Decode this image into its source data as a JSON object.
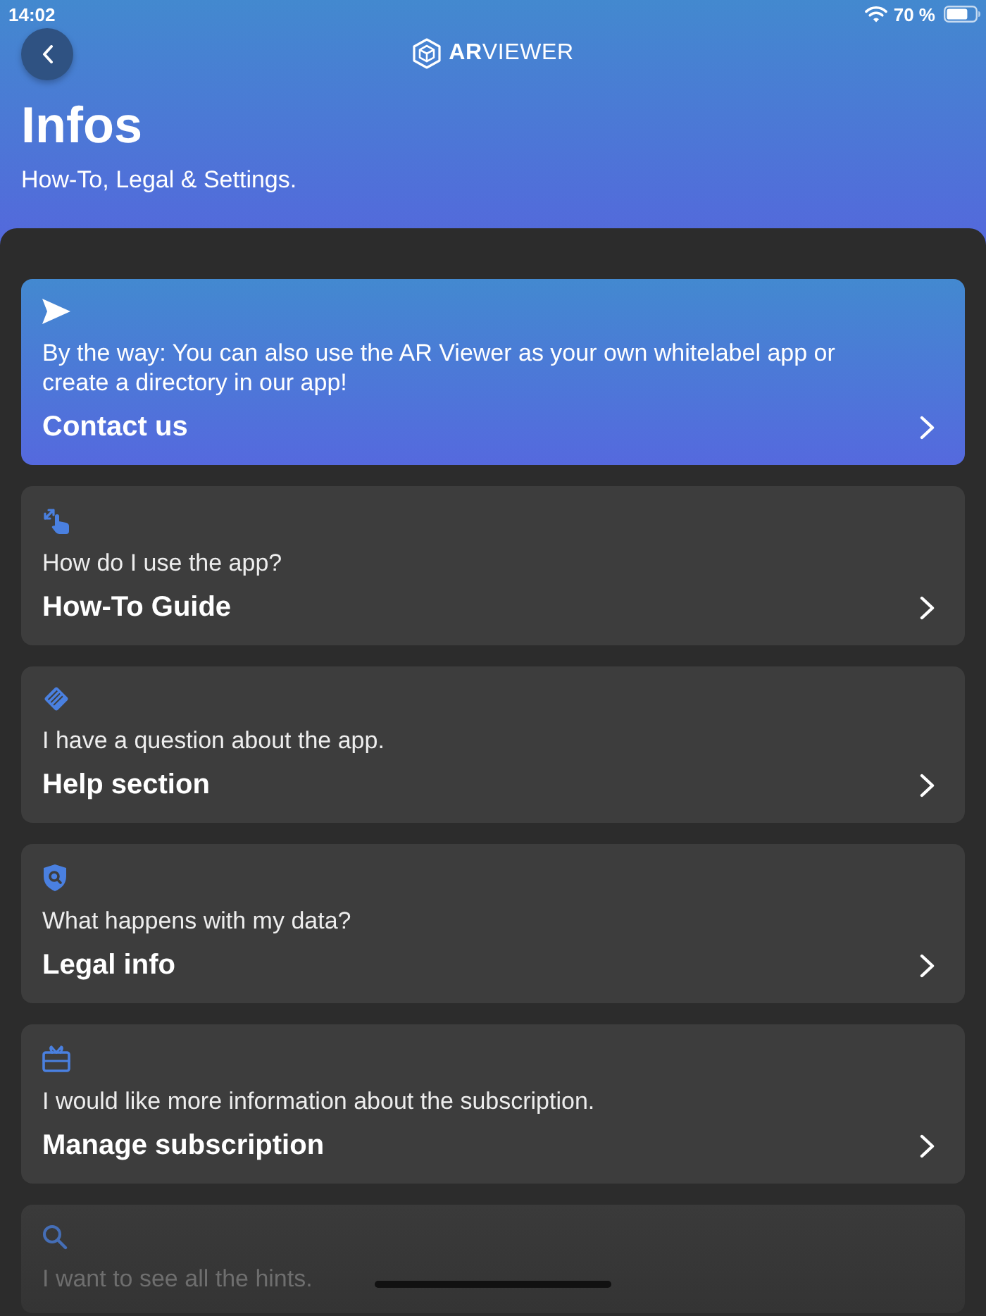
{
  "status_bar": {
    "time": "14:02",
    "battery": "70 %"
  },
  "header": {
    "logo": "**AR**VIEWER",
    "title": "Infos",
    "subtitle": "How-To, Legal & Settings."
  },
  "promo_card": {
    "text": "By the way: You can also use the AR Viewer as your own whitelabel app or create a directory in our app!",
    "title": "Contact us"
  },
  "items": [
    {
      "question": "How do I use the app?",
      "title": "How-To Guide",
      "faded": false
    },
    {
      "question": "I have a question about the app.",
      "title": "Help section",
      "faded": false
    },
    {
      "question": "What happens with my data?",
      "title": "Legal info",
      "faded": false
    },
    {
      "question": "I would like more information about the subscription.",
      "title": "Manage subscription",
      "faded": false
    },
    {
      "question": "I want to see all the hints.",
      "faded": true
    }
  ]
}
